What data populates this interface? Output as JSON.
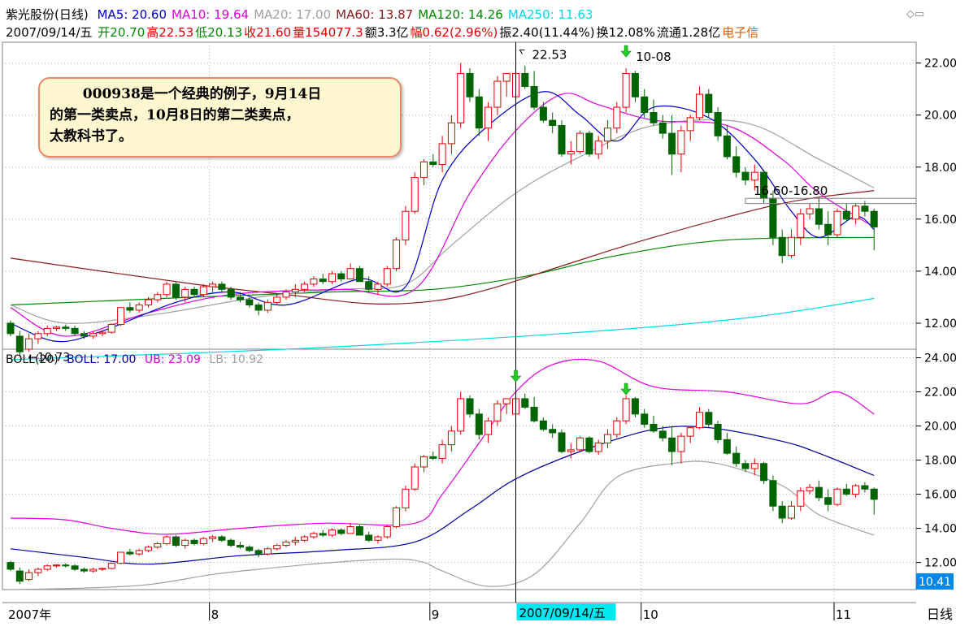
{
  "header": {
    "title": "紫光股份(日线)",
    "ma": [
      {
        "label": "MA5: 20.60",
        "color": "#0000c8"
      },
      {
        "label": "MA10: 19.64",
        "color": "#e000e0"
      },
      {
        "label": "MA20: 17.00",
        "color": "#a0a0a0"
      },
      {
        "label": "MA60: 13.87",
        "color": "#8b1a1a"
      },
      {
        "label": "MA120: 14.26",
        "color": "#008800"
      },
      {
        "label": "MA250: 11.63",
        "color": "#00d8e8"
      }
    ],
    "date": "2007/09/14/五",
    "info": [
      {
        "label": "开20.70",
        "color": "#008800"
      },
      {
        "label": "高22.53",
        "color": "#e00000"
      },
      {
        "label": "低20.13",
        "color": "#008800"
      },
      {
        "label": "收21.60",
        "color": "#e00000"
      },
      {
        "label": "量154077.3",
        "color": "#e00000"
      },
      {
        "label": "额3.3亿",
        "color": "#000000"
      },
      {
        "label": "幅0.62(2.96%)",
        "color": "#e00000"
      },
      {
        "label": "振2.40(11.44%)",
        "color": "#000000"
      },
      {
        "label": "换12.08%",
        "color": "#000000"
      },
      {
        "label": "流通1.28亿",
        "color": "#000000"
      },
      {
        "label": "电子信",
        "color": "#e05a00"
      }
    ]
  },
  "annotation": {
    "line1": "000938是一个经典的例子，9月14日",
    "line2": "的第一类卖点，10月8日的第二类卖点，",
    "line3": "太教科书了。"
  },
  "markers": {
    "high_label": "22.53",
    "second_label": "10-08",
    "low_label": "←10.73",
    "level_label": "16.60-16.80"
  },
  "boll": {
    "title": "BOLL(20)",
    "mid": "BOLL: 17.00",
    "ub": "UB: 23.09",
    "lb": "LB: 10.92",
    "current": "10.41"
  },
  "xaxis": {
    "labels": [
      {
        "text": "2007年",
        "index": 0
      },
      {
        "text": "8",
        "index": 22
      },
      {
        "text": "9",
        "index": 46
      },
      {
        "text": "10",
        "index": 69
      },
      {
        "text": "11",
        "index": 90
      }
    ],
    "cursor_label": "2007/09/14/五",
    "period": "日线"
  },
  "colors": {
    "up": "#e00000",
    "down": "#006400",
    "bull": "#e000e0",
    "boll_mid": "#0000a0",
    "boll_lb": "#a0a0a0"
  },
  "chart_data": [
    {
      "type": "candlestick",
      "title": "紫光股份(日线)",
      "ylim": [
        11.0,
        22.8
      ],
      "yticks": [
        12.0,
        14.0,
        16.0,
        18.0,
        20.0,
        22.0
      ],
      "cursor_index": 55,
      "ohlc": [
        [
          12.0,
          12.1,
          11.5,
          11.6
        ],
        [
          11.5,
          11.7,
          10.73,
          10.9
        ],
        [
          11.0,
          11.6,
          10.9,
          11.4
        ],
        [
          11.4,
          11.7,
          11.2,
          11.6
        ],
        [
          11.6,
          11.9,
          11.5,
          11.8
        ],
        [
          11.8,
          11.9,
          11.7,
          11.85
        ],
        [
          11.85,
          11.95,
          11.7,
          11.8
        ],
        [
          11.8,
          11.9,
          11.5,
          11.6
        ],
        [
          11.6,
          11.7,
          11.4,
          11.5
        ],
        [
          11.5,
          11.7,
          11.4,
          11.6
        ],
        [
          11.6,
          11.7,
          11.5,
          11.65
        ],
        [
          11.65,
          12.0,
          11.6,
          11.95
        ],
        [
          11.95,
          12.6,
          11.9,
          12.6
        ],
        [
          12.6,
          12.8,
          12.4,
          12.5
        ],
        [
          12.5,
          12.8,
          12.4,
          12.7
        ],
        [
          12.7,
          13.0,
          12.6,
          12.9
        ],
        [
          12.9,
          13.2,
          12.8,
          13.1
        ],
        [
          13.1,
          13.6,
          13.0,
          13.5
        ],
        [
          13.5,
          13.6,
          12.9,
          13.0
        ],
        [
          13.0,
          13.4,
          12.8,
          13.3
        ],
        [
          13.3,
          13.4,
          13.0,
          13.1
        ],
        [
          13.1,
          13.5,
          13.0,
          13.4
        ],
        [
          13.4,
          13.6,
          13.2,
          13.5
        ],
        [
          13.5,
          13.6,
          13.2,
          13.3
        ],
        [
          13.3,
          13.4,
          12.9,
          13.0
        ],
        [
          13.0,
          13.2,
          12.8,
          12.9
        ],
        [
          12.9,
          13.0,
          12.6,
          12.7
        ],
        [
          12.7,
          12.8,
          12.3,
          12.5
        ],
        [
          12.5,
          12.9,
          12.4,
          12.8
        ],
        [
          12.8,
          13.1,
          12.7,
          13.0
        ],
        [
          13.0,
          13.3,
          12.9,
          13.2
        ],
        [
          13.2,
          13.5,
          13.0,
          13.3
        ],
        [
          13.3,
          13.6,
          13.2,
          13.5
        ],
        [
          13.5,
          13.8,
          13.4,
          13.7
        ],
        [
          13.7,
          13.9,
          13.5,
          13.6
        ],
        [
          13.6,
          14.0,
          13.5,
          13.9
        ],
        [
          13.9,
          14.0,
          13.6,
          13.7
        ],
        [
          13.7,
          14.3,
          13.7,
          14.1
        ],
        [
          14.1,
          14.2,
          13.6,
          13.6
        ],
        [
          13.6,
          13.8,
          13.2,
          13.3
        ],
        [
          13.3,
          13.6,
          13.1,
          13.5
        ],
        [
          13.5,
          14.2,
          13.4,
          14.1
        ],
        [
          14.1,
          15.3,
          14.0,
          15.2
        ],
        [
          15.2,
          16.5,
          15.0,
          16.3
        ],
        [
          16.3,
          17.8,
          16.2,
          17.6
        ],
        [
          17.6,
          18.3,
          17.3,
          18.2
        ],
        [
          18.2,
          18.5,
          18.0,
          18.1
        ],
        [
          18.1,
          19.2,
          17.8,
          18.9
        ],
        [
          18.9,
          20.0,
          18.5,
          19.7
        ],
        [
          19.7,
          22.0,
          19.5,
          21.6
        ],
        [
          21.6,
          21.8,
          20.5,
          20.7
        ],
        [
          20.7,
          21.0,
          19.2,
          19.5
        ],
        [
          19.5,
          20.5,
          19.0,
          20.3
        ],
        [
          20.3,
          21.5,
          20.0,
          21.3
        ],
        [
          21.3,
          21.6,
          20.7,
          21.6
        ],
        [
          20.7,
          22.53,
          20.13,
          21.6
        ],
        [
          21.6,
          21.9,
          21.0,
          21.1
        ],
        [
          21.1,
          21.7,
          20.2,
          20.3
        ],
        [
          20.3,
          20.5,
          19.7,
          19.8
        ],
        [
          19.8,
          20.1,
          19.3,
          19.6
        ],
        [
          19.6,
          19.8,
          18.4,
          18.5
        ],
        [
          18.5,
          19.0,
          18.1,
          18.6
        ],
        [
          18.6,
          19.4,
          18.5,
          19.3
        ],
        [
          19.3,
          19.4,
          18.4,
          18.5
        ],
        [
          18.5,
          19.2,
          18.3,
          19.0
        ],
        [
          19.0,
          19.8,
          18.7,
          19.5
        ],
        [
          19.5,
          20.5,
          19.3,
          20.3
        ],
        [
          20.3,
          21.8,
          20.1,
          21.6
        ],
        [
          21.6,
          21.7,
          20.5,
          20.7
        ],
        [
          20.7,
          21.0,
          19.9,
          20.1
        ],
        [
          20.1,
          20.6,
          19.6,
          19.7
        ],
        [
          19.7,
          20.0,
          19.1,
          19.3
        ],
        [
          19.3,
          20.0,
          17.7,
          18.5
        ],
        [
          18.5,
          19.6,
          17.8,
          19.4
        ],
        [
          19.4,
          20.0,
          19.0,
          19.9
        ],
        [
          19.9,
          21.1,
          19.8,
          20.8
        ],
        [
          20.8,
          21.0,
          19.9,
          20.1
        ],
        [
          20.1,
          20.3,
          19.0,
          19.2
        ],
        [
          19.2,
          19.6,
          18.3,
          18.4
        ],
        [
          18.4,
          18.8,
          17.6,
          17.8
        ],
        [
          17.8,
          18.0,
          17.3,
          17.5
        ],
        [
          17.5,
          18.1,
          17.1,
          17.8
        ],
        [
          17.8,
          17.9,
          16.6,
          16.8
        ],
        [
          16.8,
          17.1,
          15.0,
          15.3
        ],
        [
          15.3,
          15.6,
          14.3,
          14.6
        ],
        [
          14.6,
          15.6,
          14.5,
          15.3
        ],
        [
          15.3,
          16.4,
          15.0,
          16.2
        ],
        [
          16.2,
          16.6,
          16.0,
          16.4
        ],
        [
          16.4,
          16.8,
          15.6,
          15.8
        ],
        [
          15.8,
          16.3,
          15.0,
          15.4
        ],
        [
          15.4,
          16.4,
          15.3,
          16.3
        ],
        [
          16.3,
          16.6,
          15.9,
          16.0
        ],
        [
          16.0,
          16.6,
          15.8,
          16.5
        ],
        [
          16.5,
          16.7,
          16.1,
          16.3
        ],
        [
          16.3,
          16.4,
          14.8,
          15.7
        ]
      ],
      "series": [
        {
          "name": "MA250",
          "color": "#00d8e8",
          "points": [
            [
              0,
              10.6
            ],
            [
              30,
              11.0
            ],
            [
              60,
              11.6
            ],
            [
              80,
              12.2
            ],
            [
              94,
              12.95
            ]
          ]
        },
        {
          "name": "MA120",
          "color": "#008800",
          "points": [
            [
              0,
              12.7
            ],
            [
              20,
              13.0
            ],
            [
              35,
              13.2
            ],
            [
              46,
              13.3
            ],
            [
              56,
              13.8
            ],
            [
              66,
              14.6
            ],
            [
              78,
              15.2
            ],
            [
              94,
              15.3
            ]
          ]
        },
        {
          "name": "MA60",
          "color": "#8b1a1a",
          "points": [
            [
              0,
              14.5
            ],
            [
              20,
              13.5
            ],
            [
              30,
              13.1
            ],
            [
              39,
              12.75
            ],
            [
              46,
              12.85
            ],
            [
              52,
              13.3
            ],
            [
              60,
              14.2
            ],
            [
              70,
              15.3
            ],
            [
              84,
              16.6
            ],
            [
              94,
              17.1
            ]
          ]
        },
        {
          "name": "MA20",
          "color": "#a0a0a0",
          "points": [
            [
              0,
              12.7
            ],
            [
              6,
              12.0
            ],
            [
              16,
              12.35
            ],
            [
              27,
              13.0
            ],
            [
              36,
              13.3
            ],
            [
              43,
              13.5
            ],
            [
              48,
              15.0
            ],
            [
              55,
              17.0
            ],
            [
              62,
              18.4
            ],
            [
              70,
              19.6
            ],
            [
              80,
              19.7
            ],
            [
              88,
              18.3
            ],
            [
              94,
              17.2
            ]
          ]
        },
        {
          "name": "MA10",
          "color": "#e000e0",
          "points": [
            [
              0,
              12.6
            ],
            [
              6,
              11.5
            ],
            [
              15,
              12.4
            ],
            [
              24,
              13.1
            ],
            [
              36,
              13.3
            ],
            [
              44,
              13.3
            ],
            [
              50,
              17.0
            ],
            [
              55,
              19.4
            ],
            [
              60,
              20.8
            ],
            [
              64,
              20.4
            ],
            [
              70,
              19.8
            ],
            [
              78,
              19.6
            ],
            [
              84,
              18.3
            ],
            [
              88,
              17.0
            ],
            [
              94,
              15.7
            ]
          ]
        },
        {
          "name": "MA5",
          "color": "#0000c8",
          "points": [
            [
              0,
              12.0
            ],
            [
              5,
              11.3
            ],
            [
              10,
              11.7
            ],
            [
              18,
              12.8
            ],
            [
              24,
              13.2
            ],
            [
              30,
              12.7
            ],
            [
              38,
              13.7
            ],
            [
              43,
              13.4
            ],
            [
              47,
              17.5
            ],
            [
              52,
              19.6
            ],
            [
              58,
              20.9
            ],
            [
              62,
              20.0
            ],
            [
              66,
              19.0
            ],
            [
              70,
              20.3
            ],
            [
              76,
              19.9
            ],
            [
              81,
              18.3
            ],
            [
              85,
              16.3
            ],
            [
              88,
              15.3
            ],
            [
              92,
              16.1
            ],
            [
              94,
              15.6
            ]
          ]
        }
      ]
    },
    {
      "type": "line",
      "title": "BOLL(20)",
      "ylim": [
        10.41,
        24.5
      ],
      "yticks": [
        12.0,
        14.0,
        16.0,
        18.0,
        20.0,
        22.0,
        24.0
      ],
      "series": [
        {
          "name": "UB",
          "color": "#e000e0",
          "points": [
            [
              0,
              14.6
            ],
            [
              6,
              14.5
            ],
            [
              11,
              14.0
            ],
            [
              17,
              13.65
            ],
            [
              25,
              14.0
            ],
            [
              34,
              14.3
            ],
            [
              44,
              14.3
            ],
            [
              47,
              16.0
            ],
            [
              51,
              19.0
            ],
            [
              55,
              22.0
            ],
            [
              59,
              23.6
            ],
            [
              64,
              23.8
            ],
            [
              70,
              22.3
            ],
            [
              78,
              22.0
            ],
            [
              86,
              21.3
            ],
            [
              90,
              22.0
            ],
            [
              94,
              20.7
            ]
          ]
        },
        {
          "name": "BOLL",
          "color": "#0000a0",
          "points": [
            [
              0,
              12.8
            ],
            [
              8,
              12.3
            ],
            [
              15,
              11.9
            ],
            [
              25,
              12.4
            ],
            [
              35,
              12.7
            ],
            [
              44,
              13.2
            ],
            [
              50,
              15.1
            ],
            [
              55,
              16.9
            ],
            [
              62,
              18.5
            ],
            [
              70,
              19.8
            ],
            [
              76,
              19.9
            ],
            [
              84,
              19.1
            ],
            [
              88,
              18.4
            ],
            [
              94,
              17.1
            ]
          ]
        },
        {
          "name": "LB",
          "color": "#a0a0a0",
          "points": [
            [
              0,
              10.41
            ],
            [
              8,
              10.5
            ],
            [
              15,
              10.7
            ],
            [
              22,
              11.3
            ],
            [
              27,
              11.6
            ],
            [
              35,
              12.0
            ],
            [
              42,
              12.2
            ],
            [
              45,
              12.0
            ],
            [
              47,
              11.5
            ],
            [
              52,
              10.6
            ],
            [
              57,
              11.3
            ],
            [
              62,
              14.3
            ],
            [
              66,
              17.0
            ],
            [
              72,
              17.8
            ],
            [
              77,
              17.8
            ],
            [
              84,
              16.5
            ],
            [
              88,
              14.8
            ],
            [
              94,
              13.6
            ]
          ]
        }
      ]
    }
  ]
}
